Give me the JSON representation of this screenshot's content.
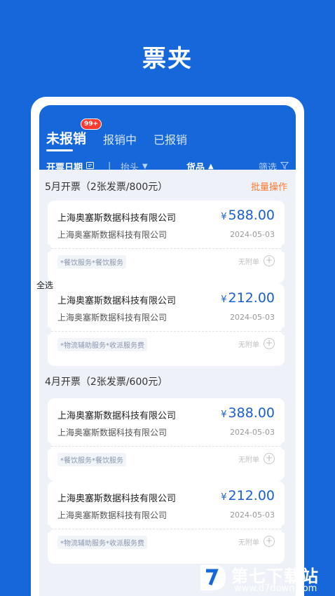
{
  "page": {
    "title": "票夹"
  },
  "tabs": [
    {
      "label": "未报销",
      "badge": "99+"
    },
    {
      "label": "报销中"
    },
    {
      "label": "已报销"
    }
  ],
  "filters": {
    "date": "开票日期",
    "divider": "|",
    "header": "抬头",
    "goods": "货品",
    "filter": "筛选"
  },
  "sections": [
    {
      "label": "5月开票（2张发票/800元）",
      "action": "批量操作"
    },
    {
      "label": "4月开票（2张发票/600元）"
    }
  ],
  "select_all": "全选",
  "invoices": [
    {
      "company": "上海奥塞斯数据科技有限公司",
      "currency": "¥",
      "amount": "588.00",
      "buyer": "上海奥塞斯数据科技有限公司",
      "date": "2024-05-03",
      "tags": "*餐饮服务*餐饮服务",
      "attach": "无附单"
    },
    {
      "company": "上海奥塞斯数据科技有限公司",
      "currency": "¥",
      "amount": "212.00",
      "buyer": "上海奥塞斯数据科技有限公司",
      "date": "2024-05-03",
      "tags": "*物流辅助服务*收派服务费",
      "attach": "无附单"
    },
    {
      "company": "上海奥塞斯数据科技有限公司",
      "currency": "¥",
      "amount": "388.00",
      "buyer": "上海奥塞斯数据科技有限公司",
      "date": "2024-05-03",
      "tags": "*餐饮服务*餐饮服务",
      "attach": "无附单"
    },
    {
      "company": "上海奥塞斯数据科技有限公司",
      "currency": "¥",
      "amount": "212.00",
      "buyer": "上海奥塞斯数据科技有限公司",
      "date": "2024-05-03",
      "tags": "*物流辅助服务*收派服务费",
      "attach": "无附单"
    }
  ],
  "watermark": {
    "name": "第七下载站",
    "url": "www.d7down.com"
  },
  "colors": {
    "brand": "#1667d9",
    "accent": "#ff7a2f",
    "badge": "#ff3b30"
  }
}
